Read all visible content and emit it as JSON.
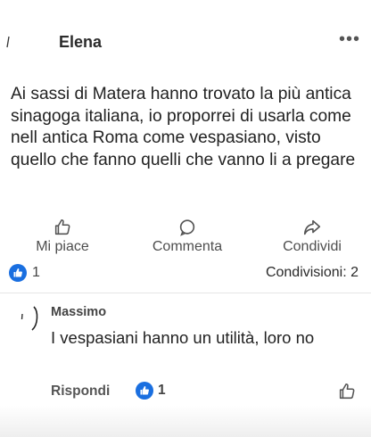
{
  "post": {
    "author": "Elena",
    "more_icon": "more-dots-icon",
    "text": "Ai sassi di Matera hanno trovato la più antica sinagoga italiana, io proporrei di usarla come nell antica Roma come vespasiano, visto quello che fanno quelli che vanno li a pregare",
    "actions": {
      "like": "Mi piace",
      "comment": "Commenta",
      "share": "Condividi"
    },
    "reaction_count": "1",
    "shares": "Condivisioni: 2"
  },
  "comment": {
    "author": "Massimo",
    "text": "I vespasiani hanno un utilità, loro no",
    "reply": "Rispondi",
    "reaction_count": "1"
  },
  "colors": {
    "like_blue": "#1a6fe0",
    "text": "#222222",
    "muted": "#4e4e4e"
  }
}
